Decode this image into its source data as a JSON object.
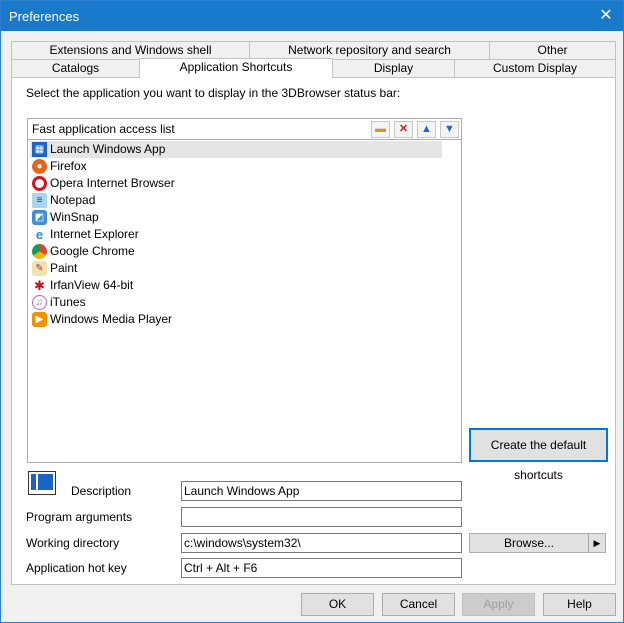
{
  "window": {
    "title": "Preferences"
  },
  "tabs_row1": [
    "Extensions and Windows shell",
    "Network repository and search",
    "Other"
  ],
  "tabs_row2": [
    "Catalogs",
    "Application Shortcuts",
    "Display",
    "Custom Display"
  ],
  "instruction": "Select the application you want to display in the 3DBrowser status bar:",
  "list": {
    "header": "Fast application access list",
    "toolbar_icons": [
      "folder-icon",
      "delete-icon",
      "arrow-up-icon",
      "arrow-down-icon"
    ],
    "items": [
      {
        "label": "Launch Windows App",
        "icon": "window-app-icon",
        "selected": true
      },
      {
        "label": "Firefox",
        "icon": "firefox-icon"
      },
      {
        "label": "Opera Internet Browser",
        "icon": "opera-icon"
      },
      {
        "label": "Notepad",
        "icon": "notepad-icon"
      },
      {
        "label": "WinSnap",
        "icon": "winsnap-icon"
      },
      {
        "label": "Internet Explorer",
        "icon": "internet-explorer-icon"
      },
      {
        "label": "Google Chrome",
        "icon": "chrome-icon"
      },
      {
        "label": "Paint",
        "icon": "paint-icon"
      },
      {
        "label": "IrfanView 64-bit",
        "icon": "irfanview-icon"
      },
      {
        "label": "iTunes",
        "icon": "itunes-icon"
      },
      {
        "label": "Windows Media Player",
        "icon": "media-player-icon"
      }
    ]
  },
  "create_default_button": "Create the default shortcuts",
  "form": {
    "description_label": "Description",
    "description_value": "Launch Windows App",
    "program_args_label": "Program arguments",
    "program_args_value": "",
    "working_dir_label": "Working directory",
    "working_dir_value": "c:\\windows\\system32\\",
    "hotkey_label": "Application hot key",
    "hotkey_value": "Ctrl + Alt + F6",
    "browse_label": "Browse..."
  },
  "buttons": {
    "ok": "OK",
    "cancel": "Cancel",
    "apply": "Apply",
    "help": "Help"
  },
  "colors": {
    "titlebar": "#1979ca",
    "focus_border": "#0078d7"
  }
}
